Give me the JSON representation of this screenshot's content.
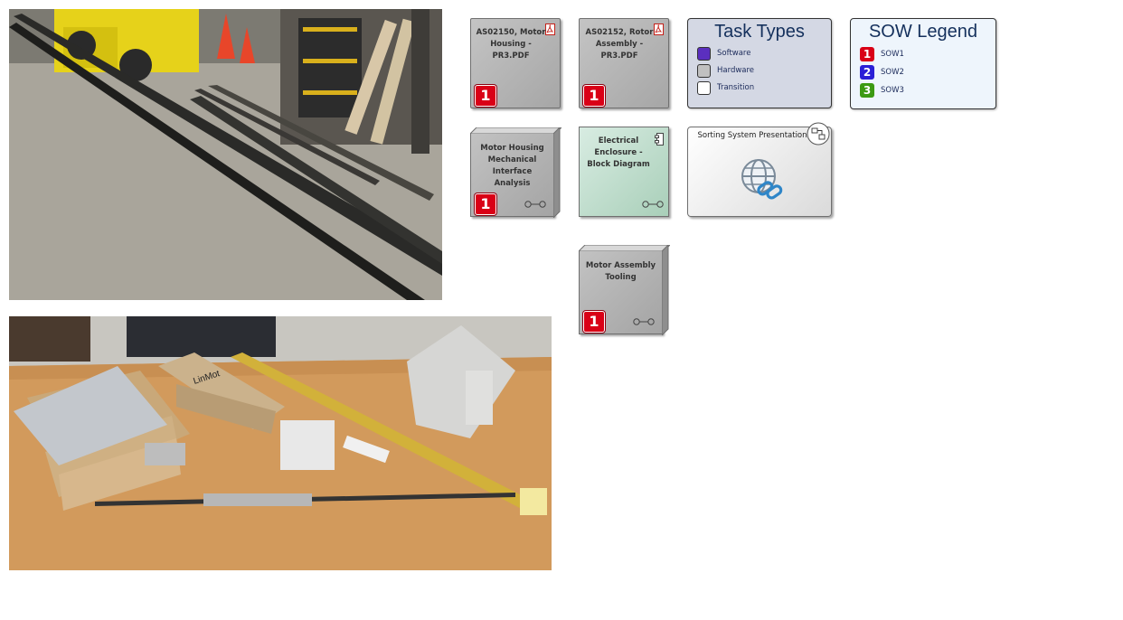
{
  "photos": {
    "warehouse": {
      "description_icon": "photo-warehouse-rails"
    },
    "linmot": {
      "box_label": "LinMot"
    }
  },
  "cards": {
    "as02150": {
      "title": "AS02150, Motor Housing - PR3.PDF",
      "badge": "1",
      "icon": "pdf-icon"
    },
    "as02152": {
      "title": "AS02152, Rotor Assembly - PR3.PDF",
      "badge": "1",
      "icon": "pdf-icon"
    },
    "motor_housing": {
      "title": "Motor Housing Mechanical Interface Analysis",
      "badge": "1",
      "icon": "link-icon"
    },
    "electrical": {
      "title": "Electrical Enclosure - Block Diagram",
      "icon": "component-icon"
    },
    "sorting": {
      "title": "Sorting System Presentation",
      "icon": "globe-link-icon"
    },
    "tooling": {
      "title": "Motor Assembly Tooling",
      "badge": "1",
      "icon": "link-icon"
    }
  },
  "task_types": {
    "title": "Task Types",
    "items": [
      {
        "label": "Software",
        "color": "#5b2fbf"
      },
      {
        "label": "Hardware",
        "color": "#c0c0c0"
      },
      {
        "label": "Transition",
        "color": "#ffffff"
      }
    ]
  },
  "sow_legend": {
    "title": "SOW Legend",
    "items": [
      {
        "num": "1",
        "label": "SOW1",
        "color": "#d90016"
      },
      {
        "num": "2",
        "label": "SOW2",
        "color": "#2a1fd6"
      },
      {
        "num": "3",
        "label": "SOW3",
        "color": "#3c9a12"
      }
    ]
  }
}
